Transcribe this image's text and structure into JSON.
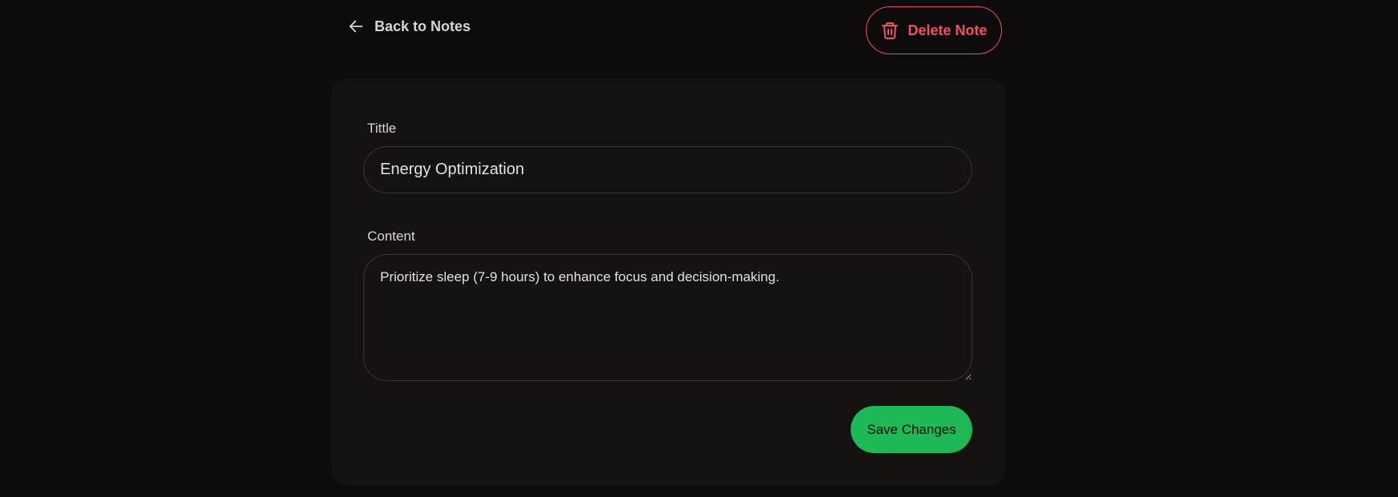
{
  "nav": {
    "back_label": "Back to Notes",
    "back_icon": "arrow-left-icon",
    "delete_label": "Delete Note",
    "delete_icon": "trash-icon"
  },
  "form": {
    "title_label": "Tittle",
    "title_value": "Energy Optimization",
    "content_label": "Content",
    "content_value": "Prioritize sleep (7-9 hours) to enhance focus and decision-making.",
    "save_label": "Save Changes"
  },
  "colors": {
    "background": "#0d0b0b",
    "card": "#161211",
    "danger": "#f0525c",
    "accent": "#1db954",
    "text": "#d8d4d2"
  }
}
